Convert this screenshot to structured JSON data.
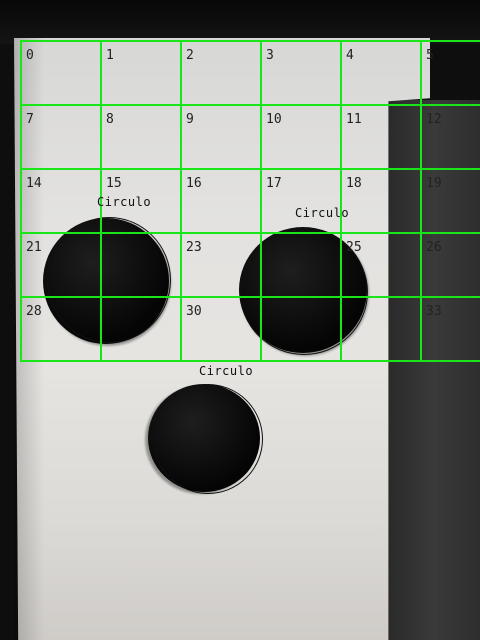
{
  "grid": {
    "color": "#19e619",
    "indices": [
      "0",
      "1",
      "2",
      "3",
      "4",
      "5",
      "7",
      "8",
      "9",
      "10",
      "11",
      "12",
      "14",
      "15",
      "16",
      "17",
      "18",
      "19",
      "21",
      "23",
      "25",
      "26",
      "28",
      "30",
      "33"
    ]
  },
  "detections": [
    {
      "label": "Circulo"
    },
    {
      "label": "Circulo"
    },
    {
      "label": "Circulo"
    }
  ]
}
